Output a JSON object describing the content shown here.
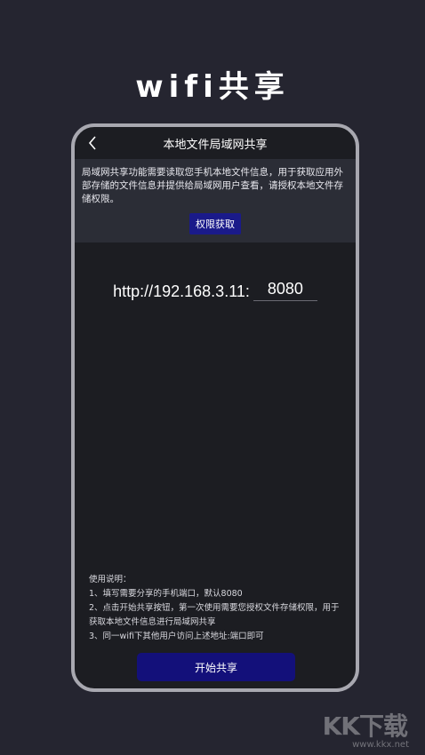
{
  "headline": "wifi共享",
  "screen": {
    "title": "本地文件局域网共享",
    "back_icon": "chevron-left-icon"
  },
  "permission": {
    "text": "局域网共享功能需要读取您手机本地文件信息，用于获取应用外部存储的文件信息并提供给局域网用户查看，请授权本地文件存储权限。",
    "button_label": "权限获取"
  },
  "url": {
    "prefix": "http://192.168.3.11:",
    "port_value": "8080"
  },
  "instructions": {
    "heading": "使用说明：",
    "lines": [
      "1、填写需要分享的手机端口，默认8080",
      "2、点击开始共享按钮，第一次使用需要您授权文件存储权限，用于获取本地文件信息进行局域网共享",
      "3、同一wifi下其他用户访问上述地址:端口即可"
    ]
  },
  "start_button_label": "开始共享",
  "watermark": {
    "logo": "KK下载",
    "url": "www.kkx.net"
  }
}
